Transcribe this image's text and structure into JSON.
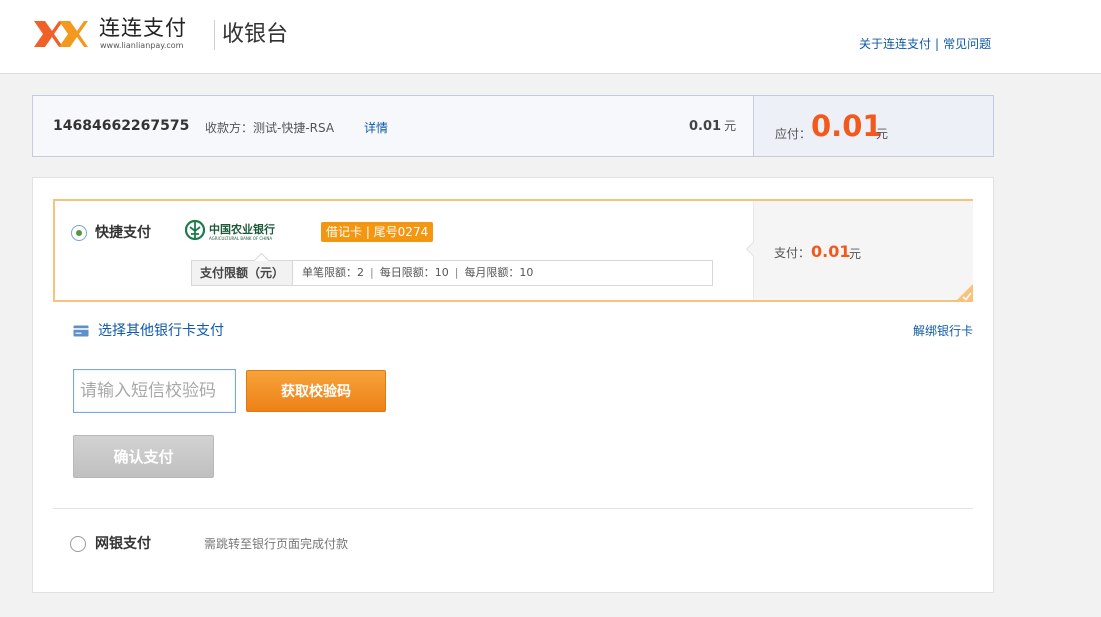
{
  "header": {
    "brand_name": "连连支付",
    "brand_url": "www.lianlianpay.com",
    "title": "收银台",
    "links": [
      {
        "label": "关于连连支付"
      },
      {
        "label": "常见问题"
      }
    ],
    "link_separator": "|"
  },
  "order": {
    "order_no": "14684662267575",
    "payee": "收款方：测试-快捷-RSA",
    "detail_label": "详情",
    "amount": "0.01",
    "amount_unit": "元",
    "due_label": "应付：",
    "due_amount": "0.01",
    "due_unit": "元"
  },
  "quick_pay": {
    "selected": true,
    "label": "快捷支付",
    "bank_name_cn": "中国农业银行",
    "bank_name_en": "AGRICULTURAL BANK OF CHINA",
    "card_tag": "借记卡 | 尾号0274",
    "limit_title": "支付限额（元）",
    "limits": [
      "单笔限额：2",
      "每日限额：10",
      "每月限额：10"
    ],
    "limit_separator": "|",
    "pay_label": "支付：",
    "pay_amount": "0.01",
    "pay_unit": "元"
  },
  "actions": {
    "other_bank_label": "选择其他银行卡支付",
    "unbind_label": "解绑银行卡",
    "sms_placeholder": "请输入短信校验码",
    "get_code_label": "获取校验码",
    "confirm_label": "确认支付"
  },
  "ebank": {
    "selected": false,
    "label": "网银支付",
    "note": "需跳转至银行页面完成付款"
  },
  "colors": {
    "accent_orange": "#f25a1d",
    "link_blue": "#0f5aa7",
    "tag_orange": "#f39712",
    "card_border": "#f6c27c",
    "bank_green": "#1d7a4c"
  },
  "icons": {
    "logo": "lianlian-logo-icon",
    "bank": "abc-bank-logo-icon",
    "other_bank": "bank-card-icon",
    "selected_corner": "checkmark-corner-icon"
  }
}
